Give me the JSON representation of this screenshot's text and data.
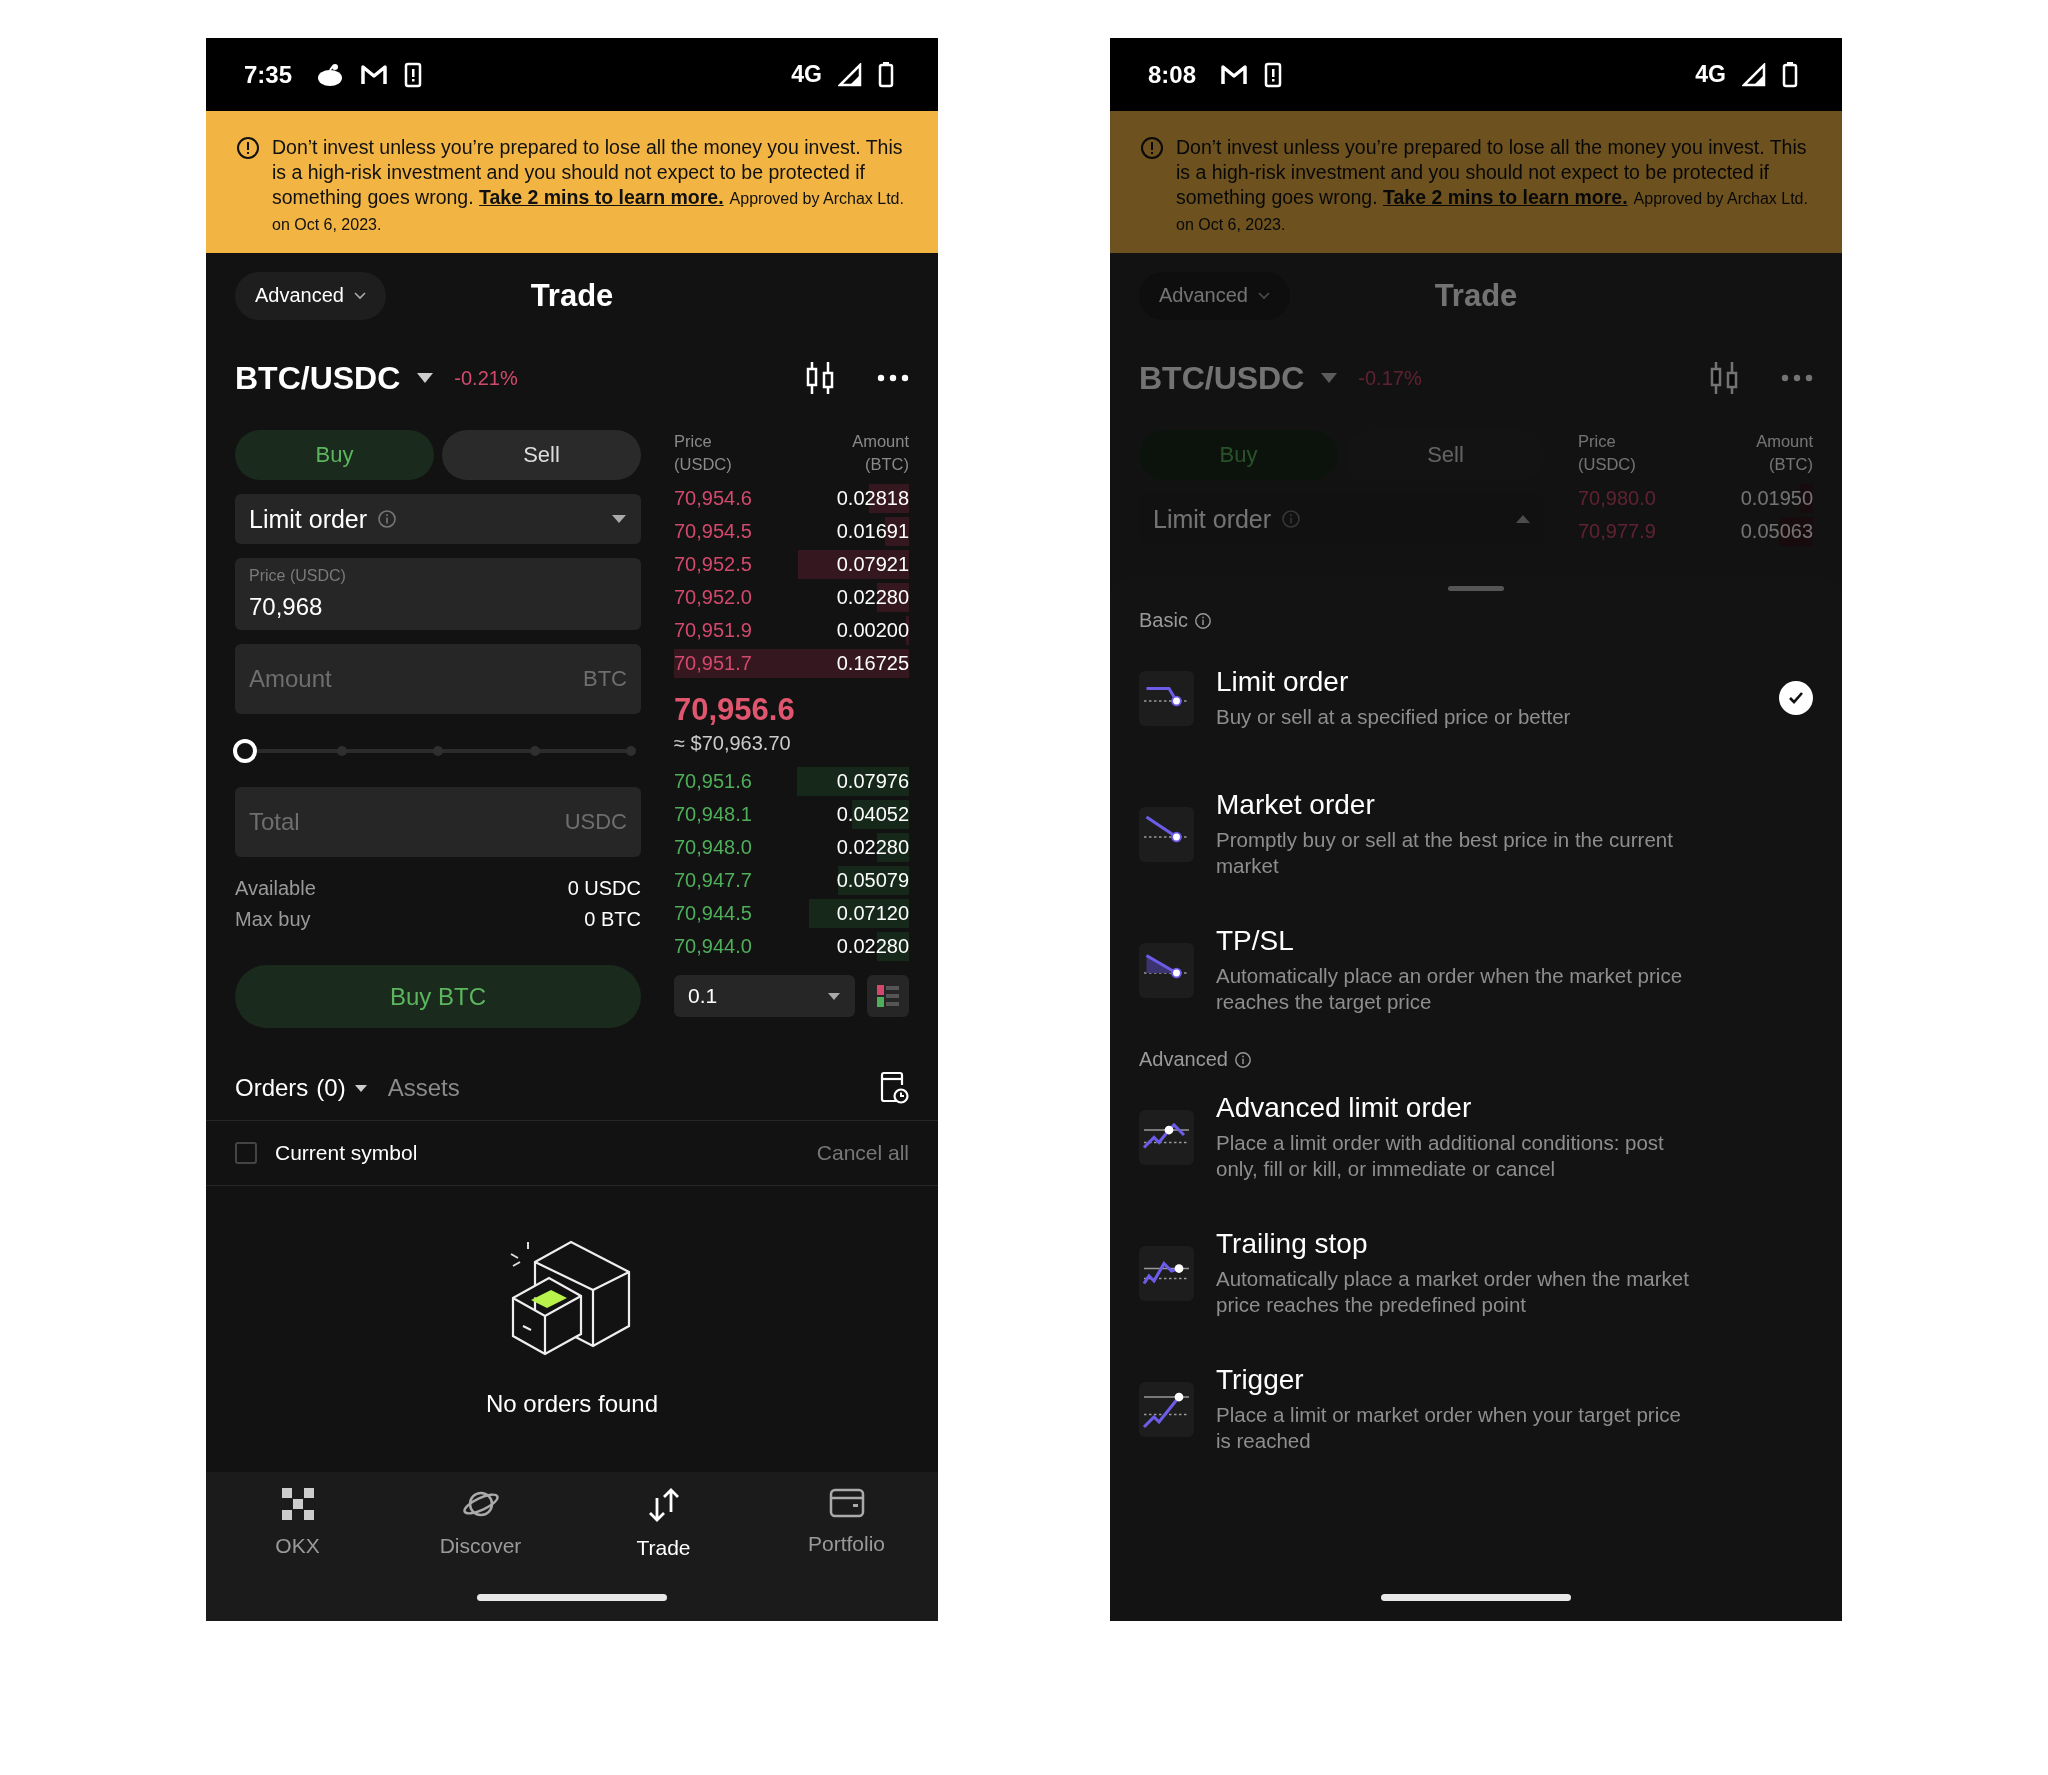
{
  "screens": [
    {
      "status_bar": {
        "time": "7:35",
        "notifications": [
          {
            "kind": "mascot"
          },
          {
            "kind": "mail"
          },
          {
            "kind": "device"
          }
        ],
        "network": "4G"
      },
      "banner": {
        "text": "Don’t invest unless you’re prepared to lose all the money you invest. This is a high-risk investment and you should not expect to be protected if something goes wrong.",
        "link": "Take 2 mins to learn more.",
        "note": "Approved by Archax Ltd. on Oct 6, 2023."
      },
      "header": {
        "mode": "Advanced",
        "title": "Trade"
      },
      "pair": {
        "symbol": "BTC/USDC",
        "change": "-0.21%"
      },
      "side_tabs": [
        {
          "label": "Buy",
          "selected": true
        },
        {
          "label": "Sell",
          "selected": false
        }
      ],
      "order_type": {
        "label": "Limit order",
        "expanded": false
      },
      "price_field": {
        "label": "Price (USDC)",
        "value": "70,968"
      },
      "amount_field": {
        "placeholder": "Amount",
        "unit": "BTC"
      },
      "slider": {
        "level": 0
      },
      "total_field": {
        "placeholder": "Total",
        "unit": "USDC"
      },
      "balances": [
        {
          "label": "Available",
          "value": "0 USDC"
        },
        {
          "label": "Max buy",
          "value": "0 BTC"
        }
      ],
      "submit_button": "Buy BTC",
      "order_book": {
        "price_header": "Price (USDC)",
        "amount_header": "Amount (BTC)",
        "asks": [
          {
            "price": "70,954.6",
            "amount": "0.02818"
          },
          {
            "price": "70,954.5",
            "amount": "0.01691"
          },
          {
            "price": "70,952.5",
            "amount": "0.07921"
          },
          {
            "price": "70,952.0",
            "amount": "0.02280"
          },
          {
            "price": "70,951.9",
            "amount": "0.00200"
          },
          {
            "price": "70,951.7",
            "amount": "0.16725"
          }
        ],
        "mid_price": "70,956.6",
        "mid_usd": "≈ $70,963.70",
        "bids": [
          {
            "price": "70,951.6",
            "amount": "0.07976"
          },
          {
            "price": "70,948.1",
            "amount": "0.04052"
          },
          {
            "price": "70,948.0",
            "amount": "0.02280"
          },
          {
            "price": "70,947.7",
            "amount": "0.05079"
          },
          {
            "price": "70,944.5",
            "amount": "0.07120"
          },
          {
            "price": "70,944.0",
            "amount": "0.02280"
          }
        ],
        "depth": "0.1"
      },
      "orders": {
        "tabs": [
          {
            "label": "Orders",
            "count": "(0)",
            "selected": true
          },
          {
            "label": "Assets",
            "selected": false
          }
        ],
        "current_symbol": {
          "label": "Current symbol",
          "checked": false
        },
        "cancel_all": "Cancel all",
        "empty_text": "No orders found"
      },
      "nav": [
        {
          "label": "OKX",
          "selected": false
        },
        {
          "label": "Discover",
          "selected": false
        },
        {
          "label": "Trade",
          "selected": true
        },
        {
          "label": "Portfolio",
          "selected": false
        }
      ]
    },
    {
      "status_bar": {
        "time": "8:08",
        "notifications": [
          {
            "kind": "mail"
          },
          {
            "kind": "device"
          }
        ],
        "network": "4G"
      },
      "banner": {
        "text": "Don’t invest unless you’re prepared to lose all the money you invest. This is a high-risk investment and you should not expect to be protected if something goes wrong.",
        "link": "Take 2 mins to learn more.",
        "note": "Approved by Archax Ltd. on Oct 6, 2023."
      },
      "header": {
        "mode": "Advanced",
        "title": "Trade"
      },
      "pair": {
        "symbol": "BTC/USDC",
        "change": "-0.17%"
      },
      "side_tabs": [
        {
          "label": "Buy",
          "selected": true
        },
        {
          "label": "Sell",
          "selected": false
        }
      ],
      "order_type": {
        "label": "Limit order",
        "expanded": true
      },
      "order_book": {
        "price_header": "Price (USDC)",
        "amount_header": "Amount (BTC)",
        "asks": [
          {
            "price": "70,980.0",
            "amount": "0.01950"
          },
          {
            "price": "70,977.9",
            "amount": "0.05063"
          }
        ]
      },
      "sheet": {
        "sections": [
          {
            "title": "Basic",
            "options": [
              {
                "title": "Limit order",
                "description": "Buy or sell at a specified price or better",
                "selected": true
              },
              {
                "title": "Market order",
                "description": "Promptly buy or sell at the best price in the current market",
                "selected": false
              },
              {
                "title": "TP/SL",
                "description": "Automatically place an order when the market price reaches the target price",
                "selected": false
              }
            ]
          },
          {
            "title": "Advanced",
            "options": [
              {
                "title": "Advanced limit order",
                "description": "Place a limit order with additional conditions: post only, fill or kill, or immediate or cancel",
                "selected": false
              },
              {
                "title": "Trailing stop",
                "description": "Automatically place a market order when the market price reaches the predefined point",
                "selected": false
              },
              {
                "title": "Trigger",
                "description": "Place a limit or market order when your target price is reached",
                "selected": false
              }
            ]
          }
        ]
      }
    }
  ]
}
